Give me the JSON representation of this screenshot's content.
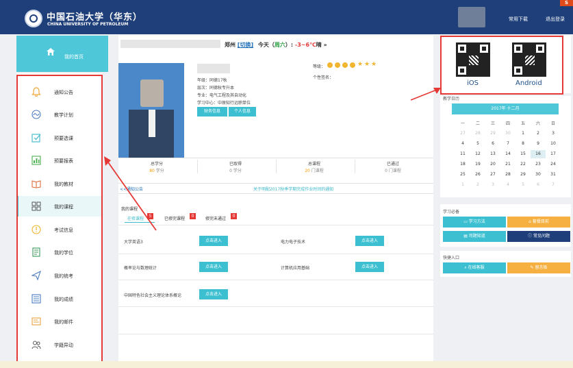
{
  "header": {
    "logo_cn": "中国石油大学（华东）",
    "logo_en": "CHINA UNIVERSITY OF PETROLEUM",
    "links": [
      "常用下载",
      "退出登录"
    ],
    "corner_badge": "S"
  },
  "sidebar": {
    "home_label": "我的首页",
    "items": [
      {
        "label": "通知公告",
        "icon": "bell-icon"
      },
      {
        "label": "教学计划",
        "icon": "wave-icon"
      },
      {
        "label": "预要选课",
        "icon": "checkbox-icon"
      },
      {
        "label": "预要报表",
        "icon": "report-icon"
      },
      {
        "label": "我的教材",
        "icon": "book-icon"
      },
      {
        "label": "我的课程",
        "icon": "grid-icon"
      },
      {
        "label": "考试信息",
        "icon": "info-icon"
      },
      {
        "label": "我的学位",
        "icon": "certificate-icon"
      },
      {
        "label": "我的统考",
        "icon": "send-icon"
      },
      {
        "label": "我的成绩",
        "icon": "scores-icon"
      },
      {
        "label": "我的邮件",
        "icon": "mail-icon"
      },
      {
        "label": "学籍异动",
        "icon": "users-icon"
      }
    ],
    "active_index": 5
  },
  "weather": {
    "city": "郑州",
    "switch": "[切换]",
    "today_prefix": "今天（",
    "weekday": "周六",
    "today_suffix": "）:",
    "temp": "-3~6℃",
    "cond": "晴",
    "more": "»"
  },
  "profile": {
    "level_label": "等级：",
    "signature_label": "个性签名：",
    "lines": [
      "年级：同德17秋",
      "层次：同德秋专升本",
      "专业：电气工程及其自动化",
      "学习中心：中原知行远职单位"
    ],
    "buttons": [
      "财务信息",
      "个人信息"
    ]
  },
  "stats": [
    {
      "label": "总学分",
      "value": "80",
      "unit": "学分"
    },
    {
      "label": "已取得",
      "value": "0",
      "unit": "学分"
    },
    {
      "label": "总课程",
      "value": "20",
      "unit": "门课程"
    },
    {
      "label": "已通过",
      "value": "0",
      "unit": "门课程"
    }
  ],
  "notice": {
    "label": "<<通知公告",
    "text": "关于明配2017秋季学期完成作业时间的通知"
  },
  "courses": {
    "title": "我的课程",
    "tabs": [
      {
        "label": "在修课程",
        "count": "5"
      },
      {
        "label": "已修完课程",
        "count": "0"
      },
      {
        "label": "修完未通过",
        "count": "0"
      }
    ],
    "enter_label": "点击进入",
    "items": [
      "大学英语3",
      "电力电子技术",
      "概率论与数理统计",
      "计算机应用基础",
      "中国特色社会主义理论体系概论"
    ]
  },
  "apps": {
    "ios": "iOS",
    "android": "Android"
  },
  "calendar": {
    "title": "教学日历",
    "month": "2017年 十二月",
    "weekdays": [
      "一",
      "二",
      "三",
      "四",
      "五",
      "六",
      "日"
    ],
    "today": "16",
    "rows": [
      [
        "27",
        "28",
        "29",
        "30",
        "1",
        "2",
        "3"
      ],
      [
        "4",
        "5",
        "6",
        "7",
        "8",
        "9",
        "10"
      ],
      [
        "11",
        "12",
        "13",
        "14",
        "15",
        "16",
        "17"
      ],
      [
        "18",
        "19",
        "20",
        "21",
        "22",
        "23",
        "24"
      ],
      [
        "25",
        "26",
        "27",
        "28",
        "29",
        "30",
        "31"
      ],
      [
        "1",
        "2",
        "3",
        "4",
        "5",
        "6",
        "7"
      ]
    ]
  },
  "study": {
    "title": "学习必备",
    "buttons": [
      "学习方法",
      "套餐目前",
      "司题知道",
      "常见问题"
    ]
  },
  "quick": {
    "title": "快捷入口",
    "buttons": [
      "在线客服",
      "留言板"
    ]
  },
  "colors": {
    "brand": "#1e3f7a",
    "accent": "#3cc0d1",
    "orange": "#f5b041",
    "annotation": "#e53935"
  }
}
